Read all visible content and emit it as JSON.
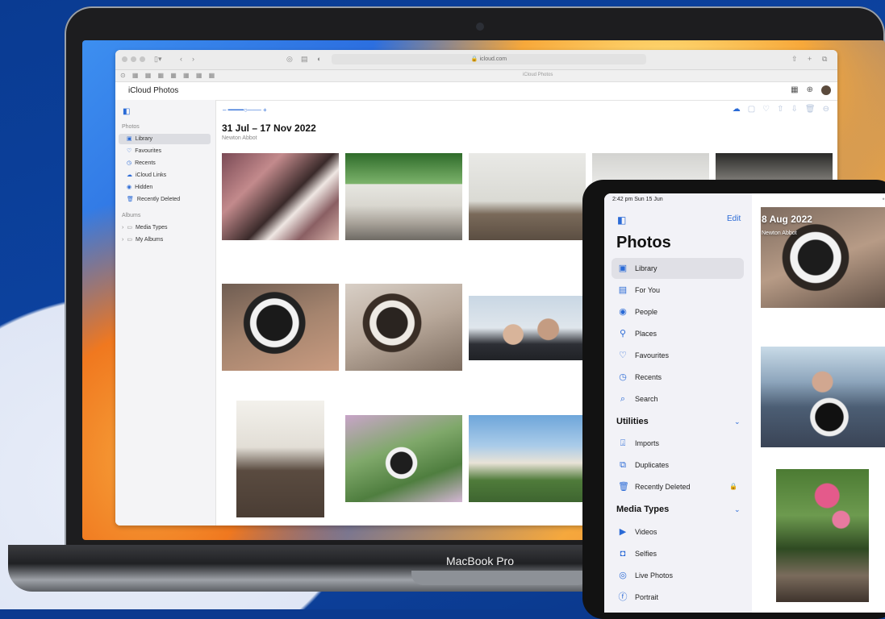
{
  "device_brand": "MacBook Pro",
  "safari": {
    "url": "icloud.com",
    "tab_title": "iCloud Photos",
    "app_title": "iCloud Photos",
    "sidebar": {
      "section_photos": "Photos",
      "items": [
        {
          "label": "Library",
          "icon": "photo-library-icon",
          "active": true
        },
        {
          "label": "Favourites",
          "icon": "heart-icon"
        },
        {
          "label": "Recents",
          "icon": "clock-icon"
        },
        {
          "label": "iCloud Links",
          "icon": "link-icon"
        },
        {
          "label": "Hidden",
          "icon": "eye-slash-icon"
        },
        {
          "label": "Recently Deleted",
          "icon": "trash-icon"
        }
      ],
      "section_albums": "Albums",
      "albums": [
        {
          "label": "Media Types"
        },
        {
          "label": "My Albums"
        }
      ]
    },
    "main": {
      "date_range": "31 Jul – 17 Nov 2022",
      "location": "Newton Abbot"
    }
  },
  "ipad": {
    "status_time": "2:42 pm  Sun 15 Jun",
    "edit_label": "Edit",
    "title": "Photos",
    "items": [
      {
        "label": "Library",
        "icon": "photo-library-icon",
        "active": true
      },
      {
        "label": "For You",
        "icon": "for-you-icon"
      },
      {
        "label": "People",
        "icon": "person-icon"
      },
      {
        "label": "Places",
        "icon": "pin-icon"
      },
      {
        "label": "Favourites",
        "icon": "heart-icon"
      },
      {
        "label": "Recents",
        "icon": "clock-icon"
      },
      {
        "label": "Search",
        "icon": "search-icon"
      }
    ],
    "utilities_heading": "Utilities",
    "utilities": [
      {
        "label": "Imports",
        "icon": "import-icon"
      },
      {
        "label": "Duplicates",
        "icon": "duplicates-icon"
      },
      {
        "label": "Recently Deleted",
        "icon": "trash-icon",
        "locked": true
      }
    ],
    "media_heading": "Media Types",
    "media": [
      {
        "label": "Videos",
        "icon": "video-icon"
      },
      {
        "label": "Selfies",
        "icon": "selfie-icon"
      },
      {
        "label": "Live Photos",
        "icon": "live-photo-icon"
      },
      {
        "label": "Portrait",
        "icon": "portrait-icon"
      }
    ],
    "main": {
      "date": "8 Aug 2022",
      "location": "Newton Abbot"
    }
  },
  "colors": {
    "accent": "#2a6ad6",
    "background": "#0b3a8f"
  }
}
